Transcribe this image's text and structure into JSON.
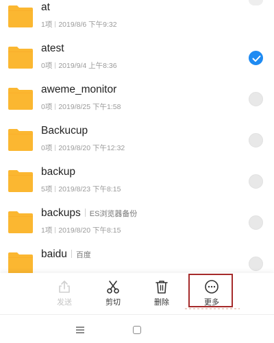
{
  "files": [
    {
      "name": "at",
      "count": "1项",
      "date": "2019/8/6 下午9:32",
      "selected": false
    },
    {
      "name": "atest",
      "count": "0项",
      "date": "2019/9/4 上午8:36",
      "selected": true
    },
    {
      "name": "aweme_monitor",
      "count": "0项",
      "date": "2019/8/25 下午1:58",
      "selected": false
    },
    {
      "name": "Backucup",
      "count": "0项",
      "date": "2019/8/20 下午12:32",
      "selected": false
    },
    {
      "name": "backup",
      "count": "5项",
      "date": "2019/8/23 下午8:15",
      "selected": false
    },
    {
      "name": "backups",
      "tag": "ES浏览器备份",
      "count": "1项",
      "date": "2019/8/20 下午8:15",
      "selected": false
    },
    {
      "name": "baidu",
      "tag": "百度",
      "count": "",
      "date": "",
      "selected": false
    }
  ],
  "actions": {
    "send": {
      "label": "发送",
      "icon": "share-icon",
      "enabled": false
    },
    "cut": {
      "label": "剪切",
      "icon": "scissors-icon",
      "enabled": true
    },
    "delete": {
      "label": "删除",
      "icon": "trash-icon",
      "enabled": true
    },
    "more": {
      "label": "更多",
      "icon": "more-icon",
      "enabled": true
    }
  },
  "colors": {
    "folder": "#fbb731",
    "folder_tab": "#f9a825",
    "accent": "#1f8bf2",
    "highlight": "#a52a2a"
  },
  "nav": {
    "menu_icon": "menu-icon",
    "home_icon": "home-icon"
  }
}
